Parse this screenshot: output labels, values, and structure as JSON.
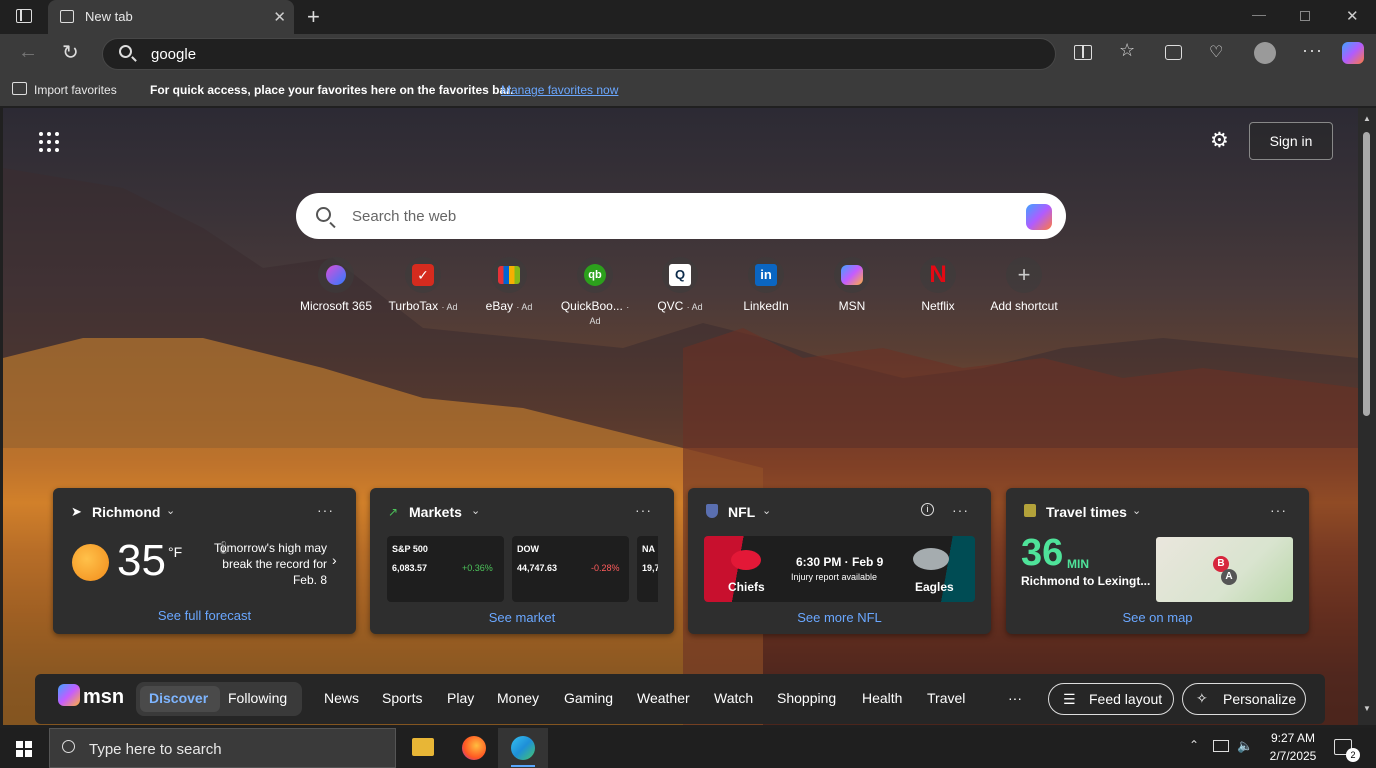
{
  "browser": {
    "tab_title": "New tab",
    "address_value": "google",
    "favorites_bar": {
      "import_label": "Import favorites",
      "message": "For quick access, place your favorites here on the favorites bar.",
      "manage_link": "Manage favorites now"
    }
  },
  "ntp": {
    "sign_in": "Sign in",
    "search_placeholder": "Search the web",
    "shortcuts": [
      {
        "label": "Microsoft 365",
        "ad": ""
      },
      {
        "label": "TurboTax",
        "ad": "· Ad"
      },
      {
        "label": "eBay",
        "ad": "· Ad"
      },
      {
        "label": "QuickBoo...",
        "ad": "· Ad"
      },
      {
        "label": "QVC",
        "ad": "· Ad"
      },
      {
        "label": "LinkedIn",
        "ad": ""
      },
      {
        "label": "MSN",
        "ad": ""
      },
      {
        "label": "Netflix",
        "ad": ""
      },
      {
        "label": "Add shortcut",
        "ad": ""
      }
    ],
    "weather": {
      "location": "Richmond",
      "temp": "35",
      "unit": "°F",
      "note": "Tomorrow's high may break the record for Feb. 8",
      "link": "See full forecast"
    },
    "markets": {
      "title": "Markets",
      "quotes": [
        {
          "name": "S&P 500",
          "value": "6,083.57",
          "change": "+0.36%",
          "color": "#4cc35a"
        },
        {
          "name": "DOW",
          "value": "44,747.63",
          "change": "-0.28%",
          "color": "#ff5c5c"
        },
        {
          "name": "NA",
          "value": "19,7",
          "change": "",
          "color": "#ffffff"
        }
      ],
      "link": "See market"
    },
    "nfl": {
      "title": "NFL",
      "home": "Chiefs",
      "away": "Eagles",
      "time": "6:30 PM · Feb 9",
      "sub": "Injury report available",
      "link": "See more NFL"
    },
    "travel": {
      "title": "Travel times",
      "minutes": "36",
      "unit": "MIN",
      "route": "Richmond to Lexingt...",
      "link": "See on map"
    },
    "feed_nav": {
      "brand": "msn",
      "discover": "Discover",
      "following": "Following",
      "items": [
        "News",
        "Sports",
        "Play",
        "Money",
        "Gaming",
        "Weather",
        "Watch",
        "Shopping",
        "Health",
        "Travel"
      ],
      "more": "···",
      "feed_layout": "Feed layout",
      "personalize": "Personalize"
    }
  },
  "taskbar": {
    "search_placeholder": "Type here to search",
    "time": "9:27 AM",
    "date": "2/7/2025",
    "notif_count": "2"
  }
}
